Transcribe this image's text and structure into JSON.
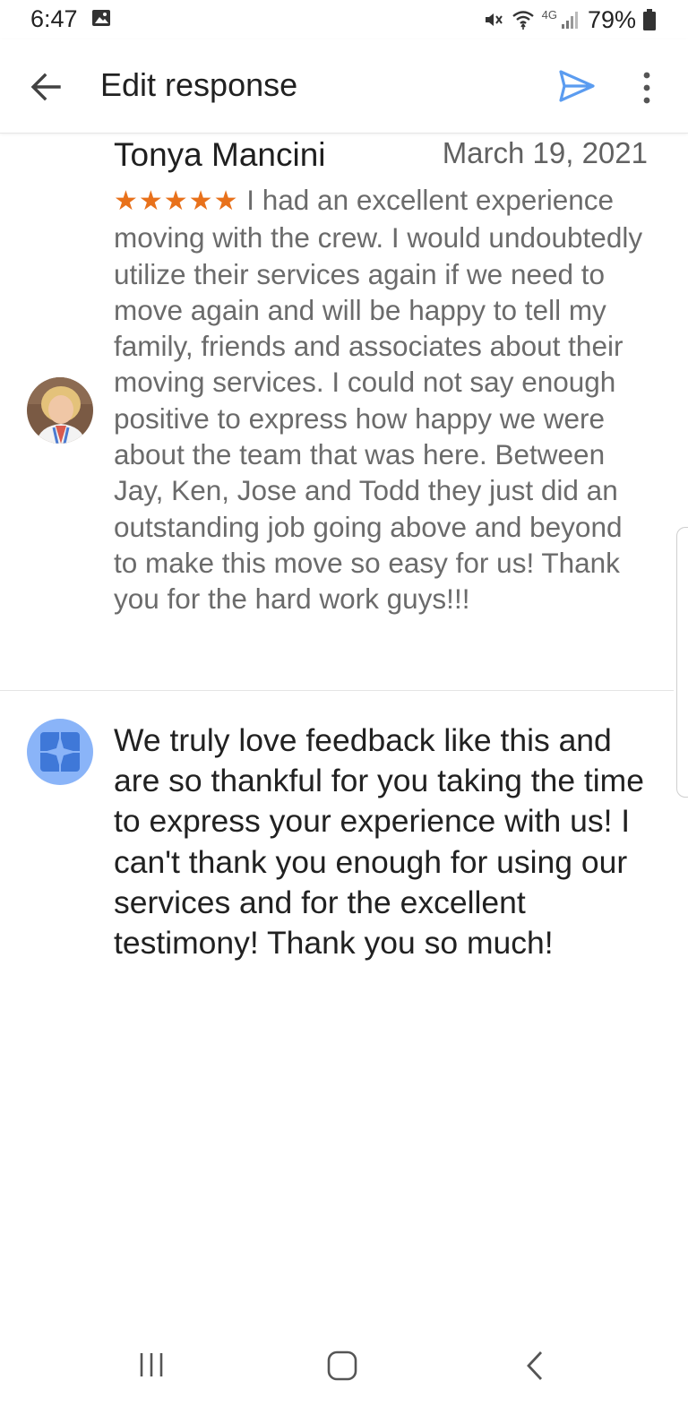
{
  "status_bar": {
    "time": "6:47",
    "network": "4G",
    "battery": "79%"
  },
  "app_bar": {
    "title": "Edit response",
    "icons": [
      "back-arrow-icon",
      "send-icon",
      "more-vert-icon"
    ],
    "accent_color": "#5b9cf0"
  },
  "review": {
    "reviewer_name": "Tonya Mancini",
    "date": "March 19, 2021",
    "rating": 5,
    "stars": "★★★★★",
    "text": "I had an excellent experience moving with the crew. I would undoubtedly utilize their services again if we need to move again and will be happy to tell my family, friends and associates about their moving services. I could not say enough positive to express how happy we were about the team that was here. Between Jay, Ken, Jose and Todd they just did an outstanding job going above and beyond to make this move so easy for us! Thank you for the hard work guys!!!",
    "star_color": "#e8711b"
  },
  "reply": {
    "text": "We truly love feedback like this and are so thankful for you taking the time to express your experience with us! I can't thank you enough for using our services and for the excellent testimony! Thank you so much!"
  },
  "nav_bar": {
    "icons": [
      "recents-icon",
      "home-icon",
      "back-icon"
    ]
  }
}
